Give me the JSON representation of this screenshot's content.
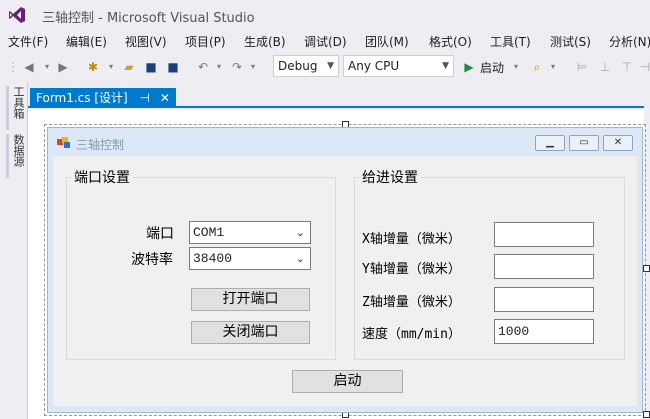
{
  "app": {
    "title": "三轴控制 - Microsoft Visual Studio"
  },
  "menu": [
    "文件(F)",
    "编辑(E)",
    "视图(V)",
    "项目(P)",
    "生成(B)",
    "调试(D)",
    "团队(M)",
    "格式(O)",
    "工具(T)",
    "测试(S)",
    "分析(N)"
  ],
  "toolbar": {
    "config": "Debug",
    "platform": "Any CPU",
    "start_label": "启动"
  },
  "left_dock": [
    "工具箱",
    "数据源"
  ],
  "doc_tab": {
    "label": "Form1.cs [设计]",
    "pin": "⊣",
    "close": "✕"
  },
  "form": {
    "title": "三轴控制",
    "port_group": {
      "title": "端口设置",
      "port_label": "端口",
      "port_value": "COM1",
      "baud_label": "波特率",
      "baud_value": "38400",
      "open_button": "打开端口",
      "close_button": "关闭端口"
    },
    "feed_group": {
      "title": "给进设置",
      "x_label": "X轴增量（微米）",
      "x_value": "",
      "y_label": "Y轴增量（微米）",
      "y_value": "",
      "z_label": "Z轴增量（微米）",
      "z_value": "",
      "speed_label": "速度（mm/min）",
      "speed_value": "1000"
    },
    "start_button": "启动"
  },
  "colors": {
    "accent": "#007ACC",
    "vs_purple": "#68217A",
    "start_green": "#1E8E3E"
  }
}
